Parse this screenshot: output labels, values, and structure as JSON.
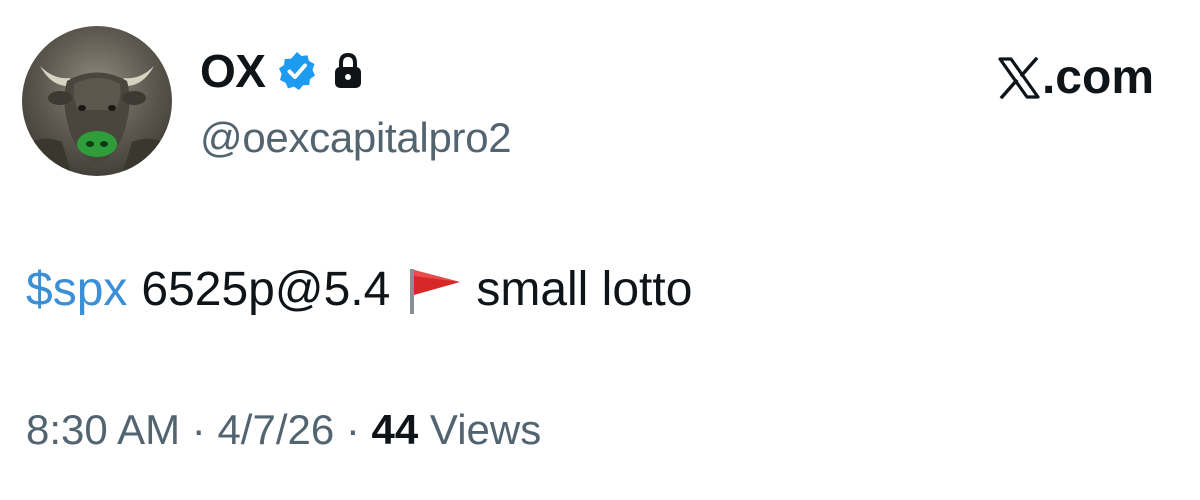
{
  "author": {
    "display_name": "OX",
    "handle": "@oexcapitalpro2",
    "verified": true,
    "protected": true,
    "avatar_icon": "bull-avatar"
  },
  "brand": {
    "label": ".com",
    "logo_icon": "x-logo-icon"
  },
  "post": {
    "cashtag": "$spx",
    "text_before_flag": "6525p@5.4",
    "flag_icon": "red-triangular-flag-icon",
    "text_after_flag": "small lotto"
  },
  "meta": {
    "time": "8:30 AM",
    "sep1": " · ",
    "date": "4/7/26",
    "sep2": " · ",
    "views_count": "44",
    "views_label": " Views"
  },
  "colors": {
    "verified_blue": "#1d9bf0",
    "cashtag_blue": "#3a8fd6",
    "secondary_text": "#536471",
    "primary_text": "#0f1419",
    "flag_red": "#d62828"
  }
}
